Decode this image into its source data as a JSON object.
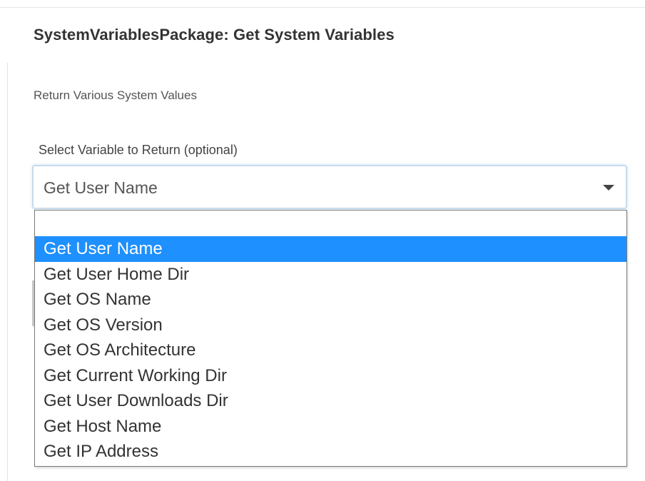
{
  "header": {
    "title": "SystemVariablesPackage: Get System Variables",
    "description": "Return Various System Values"
  },
  "field": {
    "label": "Select Variable to Return (optional)",
    "selected_value": "Get User Name",
    "options": [
      "",
      "Get User Name",
      "Get User Home Dir",
      "Get OS Name",
      "Get OS Version",
      "Get OS Architecture",
      "Get Current Working Dir",
      "Get User Downloads Dir",
      "Get Host Name",
      "Get IP Address"
    ],
    "highlighted_option": "Get User Name"
  },
  "colors": {
    "highlight": "#1e90ff",
    "text": "#333333"
  },
  "icons": {
    "select_caret": "caret-down-icon"
  }
}
